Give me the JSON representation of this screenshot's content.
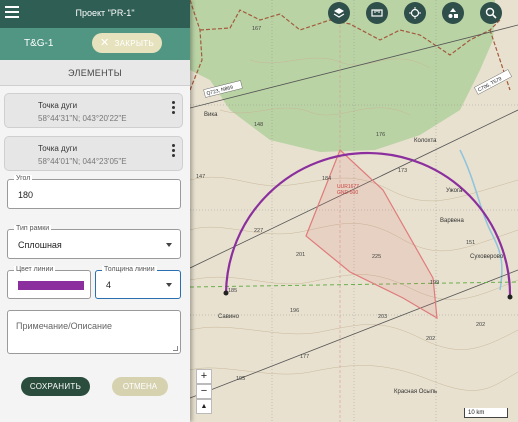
{
  "topbar": {
    "title": "Проект \"PR-1\""
  },
  "subbar": {
    "name": "T&G-1",
    "remove_label": "ЗАКРЫТЬ"
  },
  "elements": {
    "heading": "ЭЛЕМЕНТЫ",
    "items": [
      {
        "label": "Точка дуги",
        "coord": "58°44'31\"N; 043°20'22\"E"
      },
      {
        "label": "Точка дуги",
        "coord": "58°44'01\"N; 044°23'05\"E"
      }
    ]
  },
  "form": {
    "angle_label": "Угол",
    "angle_value": "180",
    "frame_type_label": "Тип рамки",
    "frame_type_value": "Сплошная",
    "line_color_label": "Цвет линии",
    "line_color_value": "#8b2f9e",
    "line_width_label": "Толщина линии",
    "line_width_value": "4",
    "note_placeholder": "Примечание/Описание"
  },
  "actions": {
    "save": "СОХРАНИТЬ",
    "cancel": "ОТМЕНА"
  },
  "map": {
    "toolbar_icons": [
      "layers-icon",
      "ruler-icon",
      "locate-icon",
      "shapes-icon",
      "search-icon"
    ],
    "zoom_in": "+",
    "zoom_out": "−",
    "compass": "▲",
    "scale_label": "10 km",
    "road_labels": [
      "Q723, N869",
      "C706, T579"
    ],
    "airspace_label": [
      "UUR1677",
      "GND-500"
    ],
    "places": [
      "Вика",
      "Колохта",
      "Варвена",
      "Ужога",
      "Суховерово",
      "Савино",
      "Красная Осыпь"
    ],
    "heights": [
      "167",
      "148",
      "176",
      "173",
      "147",
      "184",
      "227",
      "201",
      "225",
      "151",
      "185",
      "196",
      "199",
      "203",
      "202",
      "202",
      "177",
      "195"
    ],
    "colors": {
      "arc": "#8b2f9e",
      "polygon": "#e07b7b",
      "forest": "#b9d3a4",
      "terrain": "#e8e1cf",
      "toolbar": "#2f4f4a"
    }
  }
}
